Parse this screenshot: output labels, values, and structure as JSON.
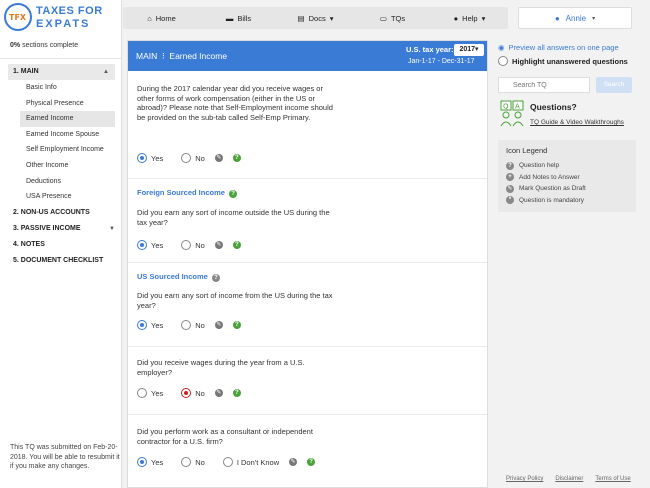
{
  "logo": {
    "mark": "TFX",
    "line1": "TAXES FOR",
    "line2": "EXPATS"
  },
  "progress": {
    "percent": "0%",
    "text": "sections complete"
  },
  "sidebar": {
    "sections": [
      {
        "label": "1. MAIN",
        "active": true
      },
      {
        "label": "2. NON-US ACCOUNTS"
      },
      {
        "label": "3. PASSIVE INCOME"
      },
      {
        "label": "4. NOTES"
      },
      {
        "label": "5. DOCUMENT CHECKLIST"
      }
    ],
    "main_items": [
      "Basic Info",
      "Physical Presence",
      "Earned Income",
      "Earned Income Spouse",
      "Self Employment Income",
      "Other Income",
      "Deductions",
      "USA Presence"
    ],
    "submitted_note": "This TQ was submitted on Feb-20-2018. You will be able to resubmit it if you make any changes."
  },
  "topnav": {
    "home": "Home",
    "bills": "Bills",
    "docs": "Docs",
    "tqs": "TQs",
    "help": "Help",
    "user": "Annie"
  },
  "main": {
    "title": "MAIN",
    "subtitle": "Earned Income",
    "tax_year_label": "U.S. tax year:",
    "tax_year": "2017",
    "range": "Jan-1-17 - Dec-31-17",
    "questions": [
      {
        "text": "During the 2017 calendar year did you receive wages or other forms of work compensation (either in the US or abroad)? Please note that Self-Employment income should be provided on the sub-tab called Self-Emp Primary.",
        "options": [
          "Yes",
          "No"
        ]
      },
      {
        "subtitle": "Foreign Sourced Income",
        "text": "Did you earn any sort of income outside the US during the tax year?",
        "options": [
          "Yes",
          "No"
        ]
      },
      {
        "subtitle": "US Sourced Income",
        "text": "Did you earn any sort of income from the US during the tax year?",
        "options": [
          "Yes",
          "No"
        ]
      },
      {
        "text": "Did you receive wages during the year from a U.S. employer?",
        "options": [
          "Yes",
          "No"
        ]
      },
      {
        "text": "Did you perform work as a consultant or independent contractor for a U.S. firm?",
        "options": [
          "Yes",
          "No",
          "I Don't Know"
        ]
      }
    ]
  },
  "right": {
    "preview": "Preview all answers on one page",
    "highlight": "Highlight unanswered questions",
    "search_placeholder": "Search TQ",
    "search_button": "Search",
    "questions_head": "Questions?",
    "questions_link": "TQ Guide & Video Walkthroughs",
    "legend_title": "Icon Legend",
    "legend": [
      "Question help",
      "Add Notes to Answer",
      "Mark Question as Draft",
      "Question is mandatory"
    ]
  },
  "footer": {
    "privacy": "Privacy Policy",
    "disclaimer": "Disclaimer",
    "terms": "Terms of Use"
  },
  "colors": {
    "accent": "#3a7bd5",
    "help_green": "#4aa33a",
    "error_red": "#cc2222"
  }
}
